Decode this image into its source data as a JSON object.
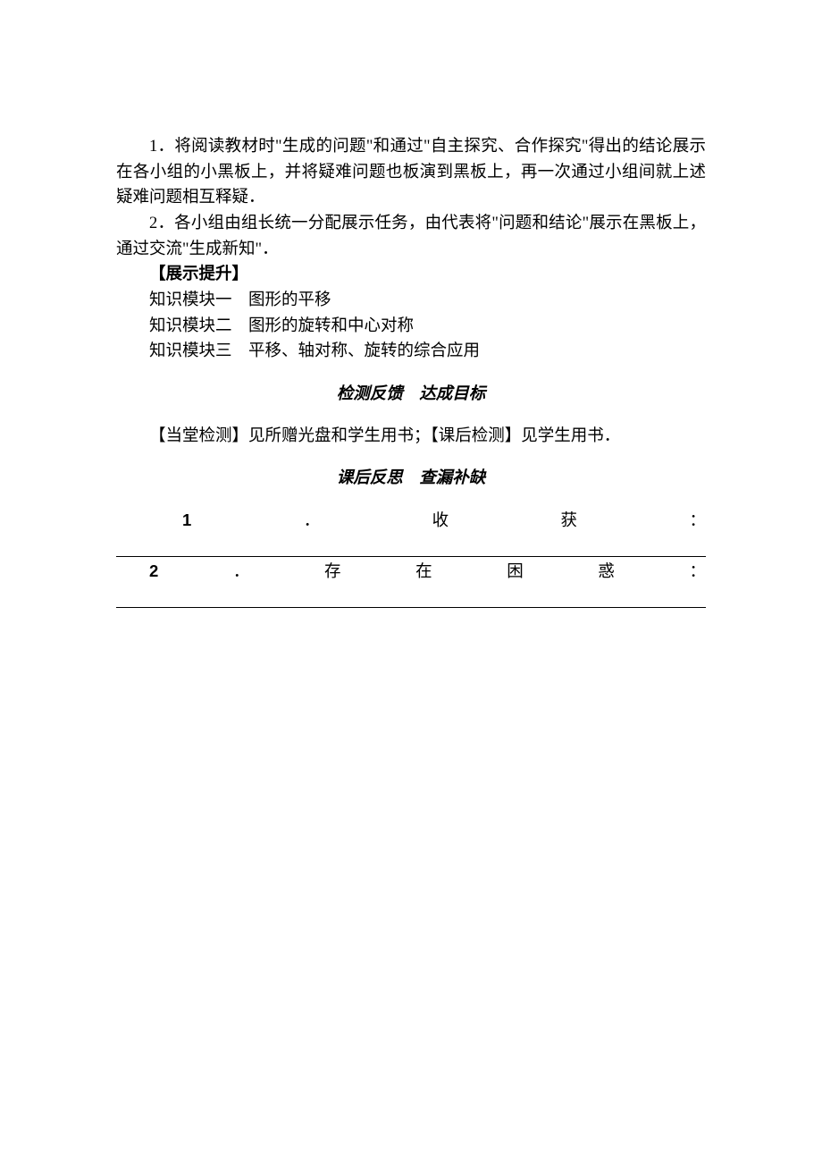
{
  "para1": "1．将阅读教材时\"生成的问题\"和通过\"自主探究、合作探究\"得出的结论展示在各小组的小黑板上，并将疑难问题也板演到黑板上，再一次通过小组间就上述疑难问题相互释疑．",
  "para2": "2．各小组由组长统一分配展示任务，由代表将\"问题和结论\"展示在黑板上，通过交流\"生成新知\"．",
  "heading_display": "【展示提升】",
  "module1": "知识模块一　图形的平移",
  "module2": "知识模块二　图形的旋转和中心对称",
  "module3": "知识模块三　平移、轴对称、旋转的综合应用",
  "heading_feedback": "检测反馈　达成目标",
  "check_line": "【当堂检测】见所赠光盘和学生用书；【课后检测】见学生用书．",
  "heading_reflect": "课后反思　查漏补缺",
  "reflect1": {
    "num": "1",
    "dot": "．",
    "c1": "收",
    "c2": "获",
    "colon": "："
  },
  "reflect2": {
    "num": "2",
    "dot": "．",
    "c1": "存",
    "c2": "在",
    "c3": "困",
    "c4": "惑",
    "colon": "："
  }
}
